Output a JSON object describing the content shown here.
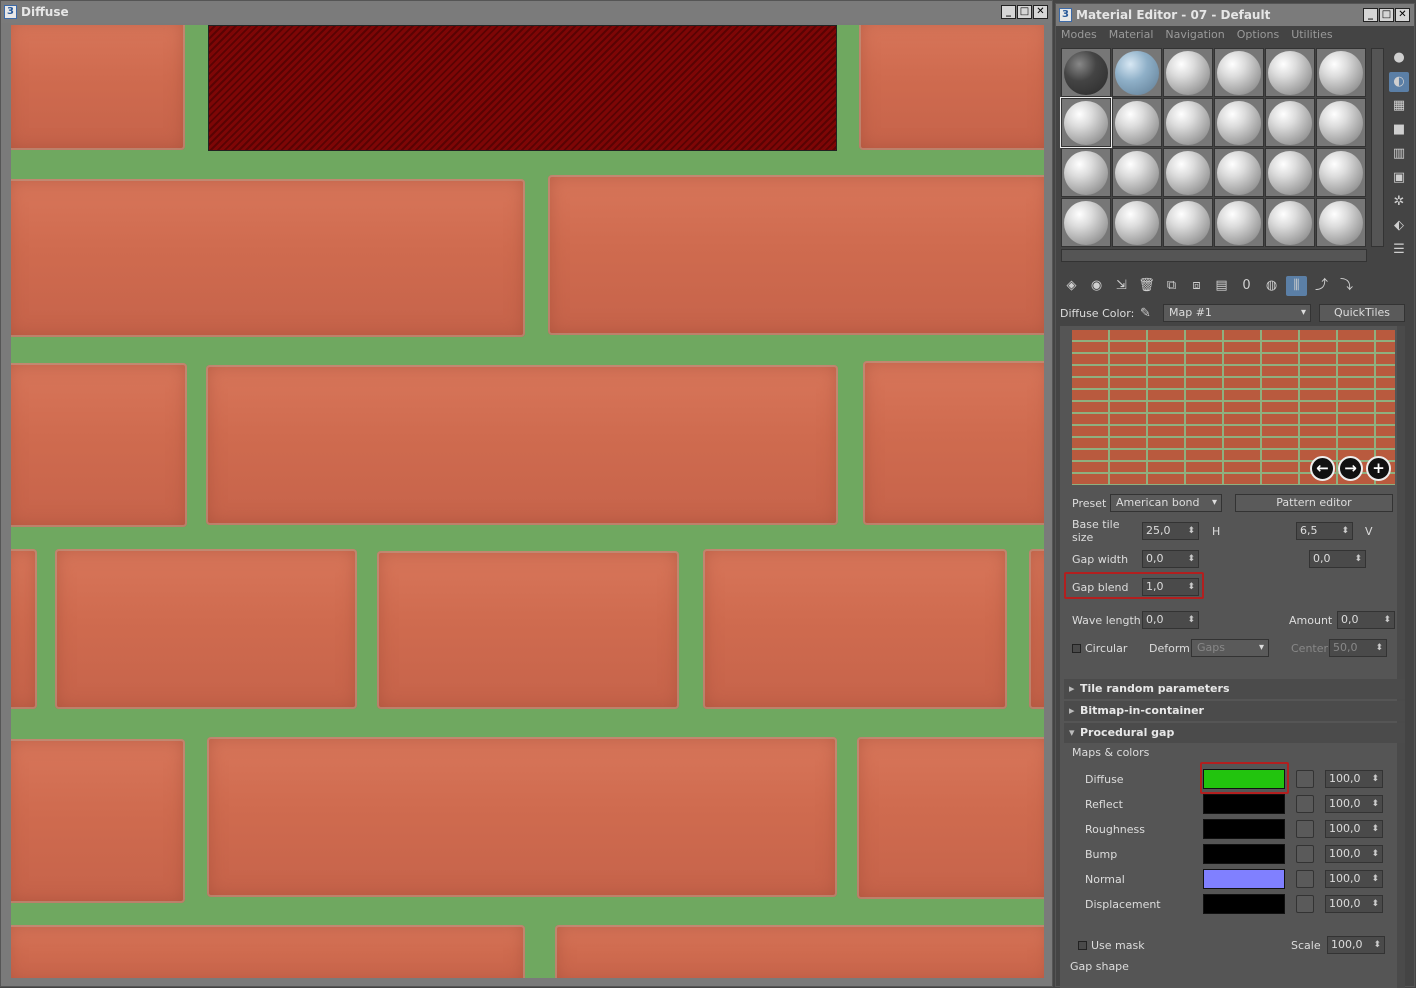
{
  "diffuse_window": {
    "title": "Diffuse",
    "app_icon": "3",
    "window_buttons": [
      "minimize-icon",
      "maximize-icon",
      "close-icon"
    ]
  },
  "material_editor": {
    "title": "Material Editor - 07 - Default",
    "app_icon": "3",
    "menu": [
      "Modes",
      "Material",
      "Navigation",
      "Options",
      "Utilities"
    ],
    "diffuse_color_label": "Diffuse Color:",
    "map_name": "Map #1",
    "quicktiles_label": "QuickTiles",
    "nav_arrows": [
      "←",
      "→",
      "+"
    ],
    "preset_label": "Preset",
    "preset_value": "American bond",
    "pattern_editor_label": "Pattern editor",
    "base_tile_size_label": "Base tile size",
    "base_tile_size_h": "25,0",
    "base_tile_size_v": "6,5",
    "h_label": "H",
    "v_label": "V",
    "gap_width_label": "Gap width",
    "gap_width_h": "0,0",
    "gap_width_v": "0,0",
    "gap_blend_label": "Gap blend",
    "gap_blend_value": "1,0",
    "wave_length_label": "Wave length",
    "wave_length_value": "0,0",
    "amount_label": "Amount",
    "amount_value": "0,0",
    "circular_label": "Circular",
    "deform_label": "Deform",
    "deform_value": "Gaps",
    "center_label": "Center",
    "center_value": "50,0",
    "rollouts": {
      "tile_random": "Tile random parameters",
      "bitmap": "Bitmap-in-container",
      "procedural_gap": "Procedural gap"
    },
    "maps_colors_label": "Maps & colors",
    "maps": [
      {
        "label": "Diffuse",
        "color": "#22c40e",
        "value": "100,0"
      },
      {
        "label": "Reflect",
        "color": "#000000",
        "value": "100,0"
      },
      {
        "label": "Roughness",
        "color": "#000000",
        "value": "100,0"
      },
      {
        "label": "Bump",
        "color": "#000000",
        "value": "100,0"
      },
      {
        "label": "Normal",
        "color": "#8080ff",
        "value": "100,0"
      },
      {
        "label": "Displacement",
        "color": "#000000",
        "value": "100,0"
      }
    ],
    "use_mask_label": "Use mask",
    "scale_label": "Scale",
    "scale_value": "100,0",
    "gap_shape_label": "Gap shape"
  }
}
